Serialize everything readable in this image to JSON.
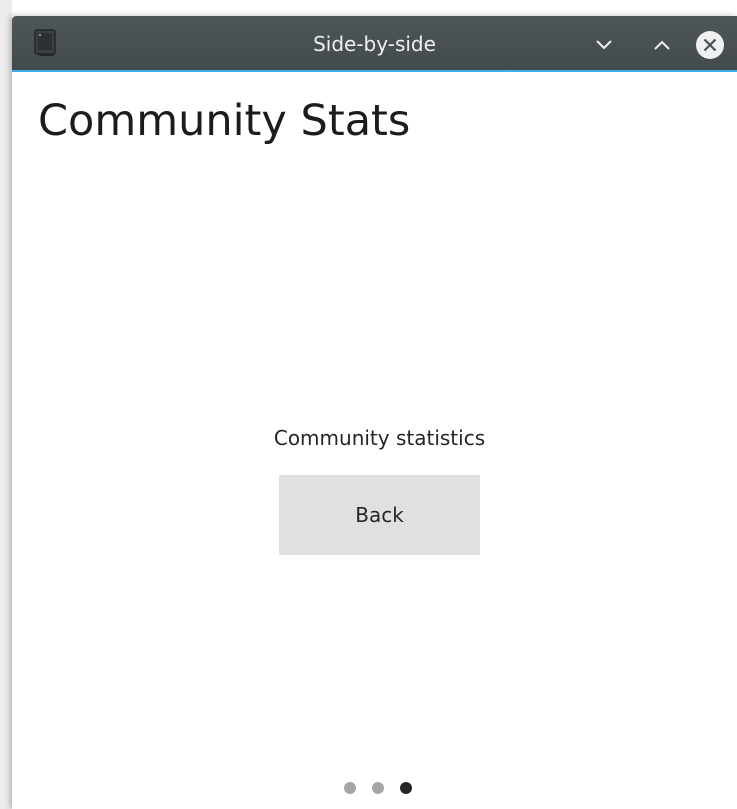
{
  "window": {
    "title": "Side-by-side",
    "icons": {
      "app": "window-app-icon",
      "minimize": "chevron-down-icon",
      "maximize": "chevron-up-icon",
      "close": "close-circle-icon"
    },
    "colors": {
      "titlebar": "#4a5154",
      "accent": "#3daee9",
      "title_text": "#eff0f1"
    }
  },
  "page": {
    "title": "Community Stats",
    "label": "Community statistics",
    "back_button": "Back"
  },
  "page_indicator": {
    "count": 3,
    "current": 3,
    "colors": {
      "active": "#262626",
      "inactive": "#a6a6a6"
    }
  }
}
